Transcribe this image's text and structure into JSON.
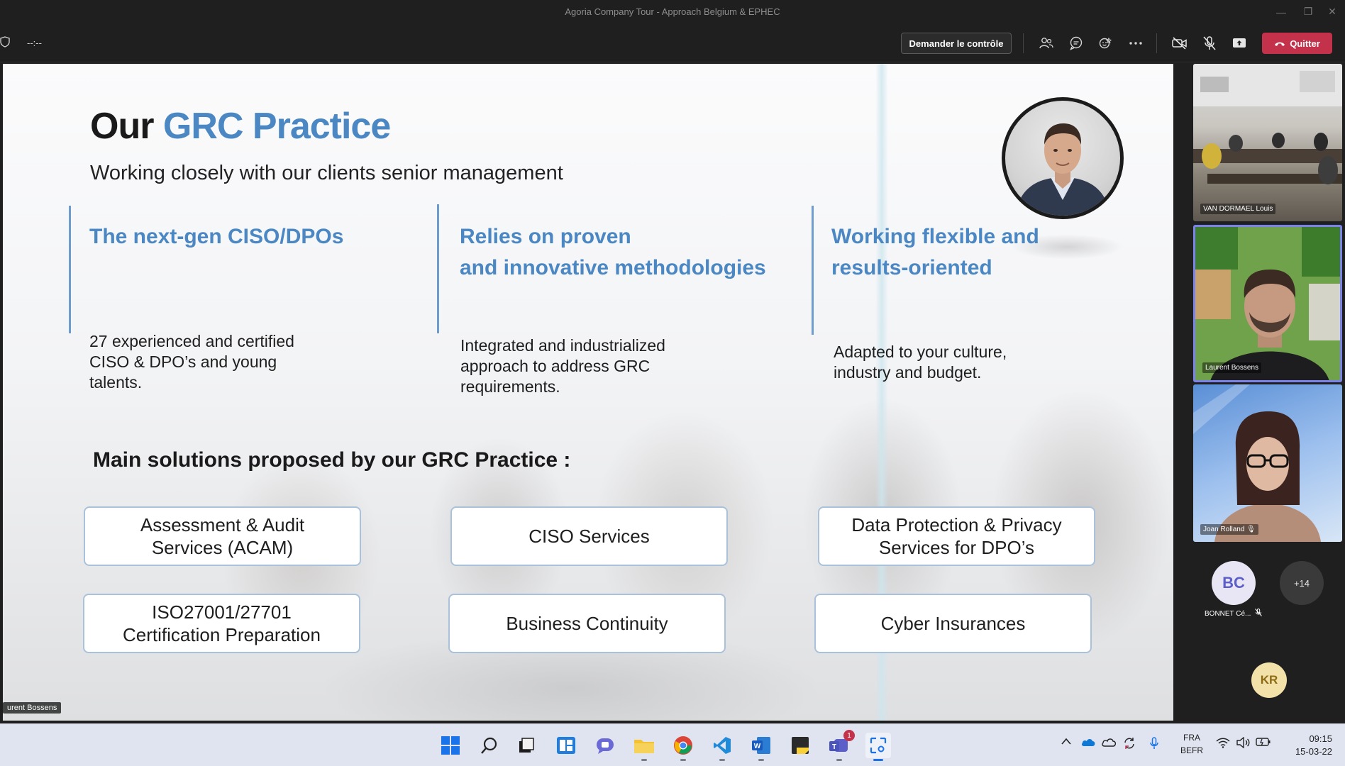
{
  "window": {
    "title": "Agoria Company Tour - Approach Belgium & EPHEC",
    "minimize": "—",
    "restore": "❐",
    "close": "✕"
  },
  "toolbar": {
    "timer": "--:--",
    "request_control_label": "Demander le contrôle",
    "quit_label": "Quitter"
  },
  "slide": {
    "title_prefix": "Our ",
    "title_accent": "GRC Practice",
    "subtitle": "Working closely with our clients senior management",
    "columns": [
      {
        "heading_line1": "The next-gen CISO/DPOs",
        "heading_line2": "",
        "body_line1": "27 experienced and certified",
        "body_line2": "CISO & DPO’s and young",
        "body_line3": "talents."
      },
      {
        "heading_line1": "Relies on proven",
        "heading_line2": "and innovative methodologies",
        "body_line1": "Integrated and industrialized",
        "body_line2": "approach to address GRC",
        "body_line3": "requirements."
      },
      {
        "heading_line1": "Working flexible and",
        "heading_line2": "results-oriented",
        "body_line1": "Adapted to your culture,",
        "body_line2": "industry and budget.",
        "body_line3": ""
      }
    ],
    "solutions_title": "Main solutions proposed by our GRC Practice :",
    "solutions": [
      {
        "line1": "Assessment & Audit",
        "line2": "Services (ACAM)"
      },
      {
        "line1": "CISO Services",
        "line2": ""
      },
      {
        "line1": "Data Protection & Privacy",
        "line2": "Services for DPO’s"
      },
      {
        "line1": "ISO27001/27701",
        "line2": "Certification Preparation"
      },
      {
        "line1": "Business Continuity",
        "line2": ""
      },
      {
        "line1": "Cyber Insurances",
        "line2": ""
      }
    ],
    "presenter_tag": "urent Bossens"
  },
  "participants": {
    "tiles": [
      {
        "name": "VAN DORMAEL Louis"
      },
      {
        "name": "Laurent Bossens"
      },
      {
        "name": "Joan Rolland"
      }
    ],
    "avatar_bc": {
      "initials": "BC",
      "name": "BONNET Cé..."
    },
    "overflow_count": "+14",
    "avatar_kr": {
      "initials": "KR"
    }
  },
  "taskbar": {
    "teams_badge": "1",
    "language_line1": "FRA",
    "language_line2": "BEFR",
    "time": "09:15",
    "date": "15-03-22"
  },
  "colors": {
    "accent_blue": "#4a87c3",
    "quit_red": "#c4314b",
    "active_tile_border": "#7b83eb"
  }
}
